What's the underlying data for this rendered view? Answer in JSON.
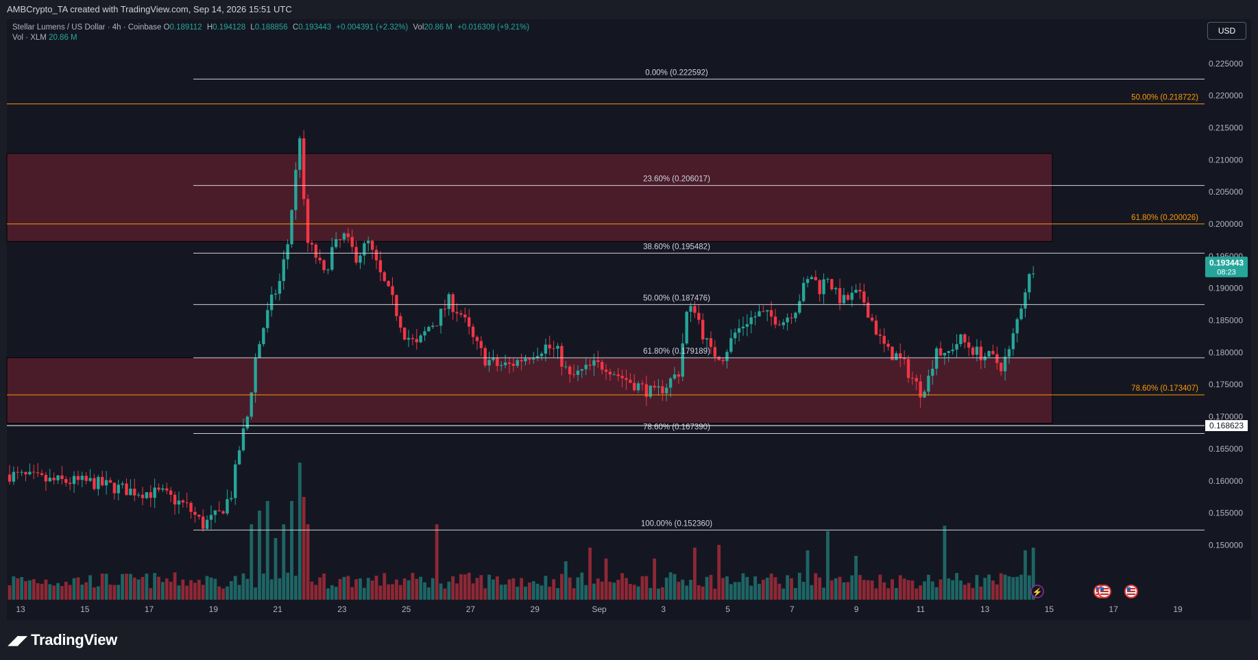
{
  "header": {
    "attribution": "AMBCrypto_TA created with TradingView.com, Sep 14, 2026 15:51 UTC"
  },
  "legend": {
    "symbol": "Stellar Lumens / US Dollar · 4h · Coinbase",
    "o_label": "O",
    "o": "0.189112",
    "h_label": "H",
    "h": "0.194128",
    "l_label": "L",
    "l": "0.188856",
    "c_label": "C",
    "c": "0.193443",
    "change": "+0.004391 (+2.32%)",
    "vol_label": "Vol",
    "vol": "20.86 M",
    "vol_change": "+0.016309 (+9.21%)",
    "vol_row_label": "Vol · XLM",
    "vol_row_value": "20.86 M"
  },
  "currency_button": "USD",
  "brand": {
    "name": "TradingView",
    "icon": "tradingview-logo-icon"
  },
  "colors": {
    "up": "#26a69a",
    "down": "#f23645",
    "fib_white": "#d1d4dc",
    "fib_orange": "#ff9800",
    "zone": "#5c1f2e",
    "price_badge": "#26a69a"
  },
  "chart_data": {
    "type": "candlestick",
    "ylim": [
      0.1445,
      0.2285
    ],
    "y_ticks": [
      "0.225000",
      "0.220000",
      "0.215000",
      "0.210000",
      "0.205000",
      "0.200000",
      "0.195000",
      "0.190000",
      "0.185000",
      "0.180000",
      "0.175000",
      "0.170000",
      "0.165000",
      "0.160000",
      "0.155000",
      "0.150000"
    ],
    "x_ticks": [
      "13",
      "15",
      "17",
      "19",
      "21",
      "23",
      "25",
      "27",
      "29",
      "Sep",
      "3",
      "5",
      "7",
      "9",
      "11",
      "13",
      "15",
      "17",
      "19"
    ],
    "last_price": "0.193443",
    "countdown": "08:23",
    "marker_price": "0.168623",
    "fib_levels_white": [
      {
        "label": "0.00% (0.222592)",
        "value": 0.222592
      },
      {
        "label": "23.60% (0.206017)",
        "value": 0.206017
      },
      {
        "label": "38.60% (0.195482)",
        "value": 0.195482
      },
      {
        "label": "50.00% (0.187476)",
        "value": 0.187476
      },
      {
        "label": "61.80% (0.179189)",
        "value": 0.179189
      },
      {
        "label": "78.60% (0.167390)",
        "value": 0.16739
      },
      {
        "label": "100.00% (0.152360)",
        "value": 0.15236
      }
    ],
    "fib_levels_orange": [
      {
        "label": "50.00% (0.218722)",
        "value": 0.218722
      },
      {
        "label": "61.80% (0.200026)",
        "value": 0.200026
      },
      {
        "label": "78.60% (0.173407)",
        "value": 0.173407
      }
    ],
    "zones": [
      {
        "top": 0.211,
        "bottom": 0.1973
      },
      {
        "top": 0.1792,
        "bottom": 0.169
      }
    ],
    "close_path": [
      [
        0,
        0.161
      ],
      [
        10,
        0.16
      ],
      [
        20,
        0.1598
      ],
      [
        30,
        0.1585
      ],
      [
        38,
        0.158
      ],
      [
        44,
        0.156
      ],
      [
        48,
        0.1532
      ],
      [
        52,
        0.1548
      ],
      [
        55,
        0.158
      ],
      [
        57,
        0.165
      ],
      [
        59,
        0.17
      ],
      [
        61,
        0.179
      ],
      [
        63,
        0.184
      ],
      [
        65,
        0.188
      ],
      [
        67,
        0.191
      ],
      [
        69,
        0.197
      ],
      [
        71,
        0.208
      ],
      [
        72,
        0.214
      ],
      [
        73,
        0.203
      ],
      [
        74,
        0.197
      ],
      [
        76,
        0.195
      ],
      [
        78,
        0.192
      ],
      [
        80,
        0.196
      ],
      [
        83,
        0.198
      ],
      [
        86,
        0.195
      ],
      [
        89,
        0.197
      ],
      [
        92,
        0.192
      ],
      [
        95,
        0.188
      ],
      [
        98,
        0.183
      ],
      [
        101,
        0.181
      ],
      [
        104,
        0.184
      ],
      [
        106,
        0.185
      ],
      [
        109,
        0.188
      ],
      [
        112,
        0.186
      ],
      [
        115,
        0.182
      ],
      [
        118,
        0.179
      ],
      [
        121,
        0.178
      ],
      [
        124,
        0.178
      ],
      [
        127,
        0.179
      ],
      [
        130,
        0.18
      ],
      [
        133,
        0.181
      ],
      [
        136,
        0.18
      ],
      [
        139,
        0.176
      ],
      [
        142,
        0.177
      ],
      [
        145,
        0.178
      ],
      [
        148,
        0.178
      ],
      [
        151,
        0.1765
      ],
      [
        154,
        0.1755
      ],
      [
        157,
        0.1745
      ],
      [
        160,
        0.1735
      ],
      [
        163,
        0.175
      ],
      [
        166,
        0.177
      ],
      [
        168,
        0.186
      ],
      [
        170,
        0.187
      ],
      [
        172,
        0.183
      ],
      [
        174,
        0.18
      ],
      [
        177,
        0.1795
      ],
      [
        180,
        0.183
      ],
      [
        183,
        0.185
      ],
      [
        186,
        0.186
      ],
      [
        189,
        0.1855
      ],
      [
        192,
        0.185
      ],
      [
        195,
        0.187
      ],
      [
        197,
        0.19
      ],
      [
        199,
        0.192
      ],
      [
        201,
        0.19
      ],
      [
        203,
        0.192
      ],
      [
        205,
        0.189
      ],
      [
        207,
        0.188
      ],
      [
        210,
        0.189
      ],
      [
        212,
        0.188
      ],
      [
        214,
        0.185
      ],
      [
        216,
        0.182
      ],
      [
        218,
        0.18
      ],
      [
        220,
        0.1795
      ],
      [
        222,
        0.178
      ],
      [
        224,
        0.176
      ],
      [
        226,
        0.174
      ],
      [
        228,
        0.176
      ],
      [
        230,
        0.181
      ],
      [
        232,
        0.179
      ],
      [
        234,
        0.181
      ],
      [
        236,
        0.182
      ],
      [
        238,
        0.181
      ],
      [
        240,
        0.18
      ],
      [
        242,
        0.1795
      ],
      [
        244,
        0.179
      ],
      [
        246,
        0.178
      ],
      [
        248,
        0.18
      ],
      [
        250,
        0.185
      ],
      [
        252,
        0.19
      ],
      [
        254,
        0.1934
      ]
    ],
    "volume": {
      "spikes": [
        {
          "i": 60,
          "v": 0.55
        },
        {
          "i": 62,
          "v": 0.65
        },
        {
          "i": 64,
          "v": 0.72
        },
        {
          "i": 66,
          "v": 0.45
        },
        {
          "i": 68,
          "v": 0.55
        },
        {
          "i": 70,
          "v": 0.72
        },
        {
          "i": 72,
          "v": 1.0
        },
        {
          "i": 73,
          "v": 0.75
        },
        {
          "i": 74,
          "v": 0.55
        },
        {
          "i": 106,
          "v": 0.55
        },
        {
          "i": 138,
          "v": 0.28
        },
        {
          "i": 144,
          "v": 0.38
        },
        {
          "i": 148,
          "v": 0.3
        },
        {
          "i": 160,
          "v": 0.3
        },
        {
          "i": 170,
          "v": 0.38
        },
        {
          "i": 176,
          "v": 0.4
        },
        {
          "i": 198,
          "v": 0.36
        },
        {
          "i": 203,
          "v": 0.5
        },
        {
          "i": 210,
          "v": 0.32
        },
        {
          "i": 232,
          "v": 0.54
        },
        {
          "i": 252,
          "v": 0.36
        },
        {
          "i": 254,
          "v": 0.38
        }
      ]
    },
    "event_markers": [
      "lightning-icon",
      "us-flag-icon",
      "us-flag-icon",
      "us-flag-icon"
    ]
  }
}
